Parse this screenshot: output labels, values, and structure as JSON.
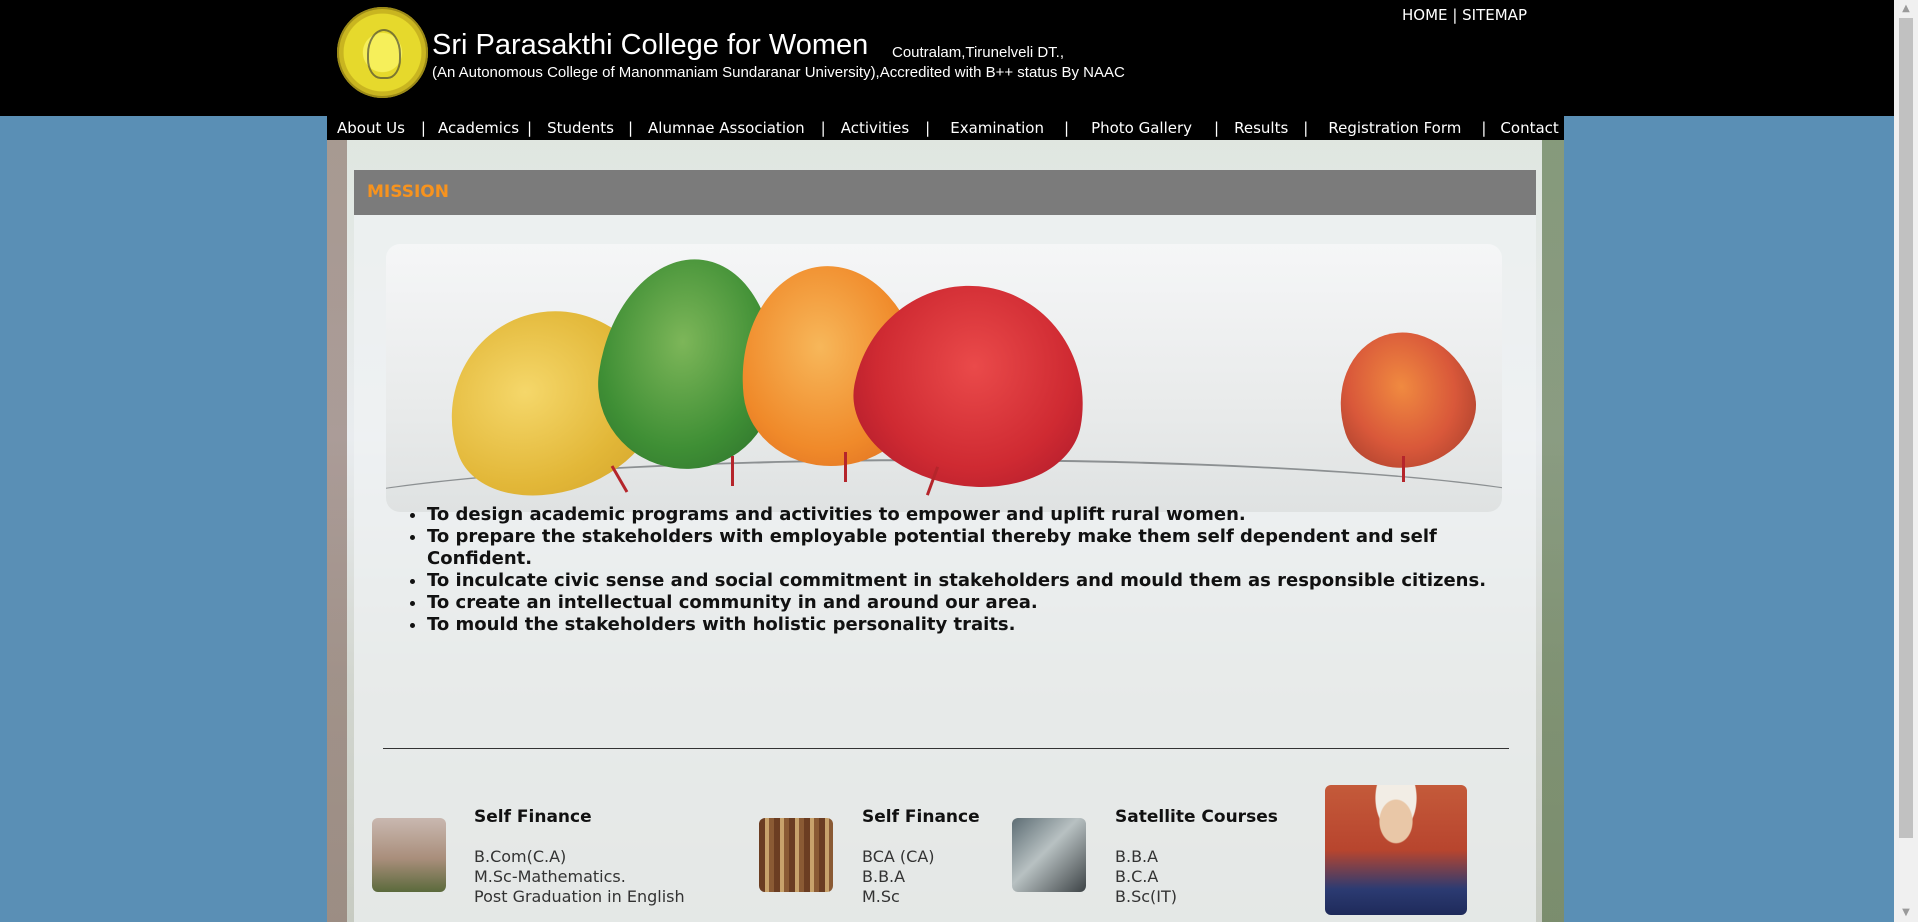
{
  "header": {
    "college_name": "Sri Parasakthi College for Women",
    "place": "Coutralam,Tirunelveli DT.,",
    "subtitle": "(An Autonomous College of Manonmaniam Sundaranar University),Accredited with B++ status By NAAC",
    "top_links": {
      "home": "HOME",
      "separator": "|",
      "sitemap": "SITEMAP"
    }
  },
  "nav": {
    "separator": "|",
    "items": [
      "About Us",
      "Academics",
      "Students",
      "Alumnae Association",
      "Activities",
      "Examination",
      "Photo Gallery",
      "Results",
      "Registration Form",
      "Contact"
    ]
  },
  "panel": {
    "title": "MISSION",
    "mission": [
      "To design academic programs and activities to empower and uplift rural women.",
      "To prepare the stakeholders with employable potential thereby make them self dependent and self Confident.",
      "To inculcate civic sense and social commitment in stakeholders and mould them as responsible citizens.",
      "To create an intellectual community in and around our area.",
      "To mould the stakeholders with holistic personality traits."
    ]
  },
  "courses": [
    {
      "title": "Self Finance",
      "lines": [
        "B.Com(C.A)",
        "M.Sc-Mathematics.",
        "Post Graduation in English"
      ]
    },
    {
      "title": "Self Finance",
      "lines": [
        "BCA (CA)",
        "B.B.A",
        "M.Sc"
      ]
    },
    {
      "title": "Satellite Courses",
      "lines": [
        "B.B.A",
        "B.C.A",
        "B.Sc(IT)"
      ]
    }
  ],
  "icons": {
    "logo": "college-emblem-icon",
    "thumb1": "building-photo-icon",
    "thumb2": "bookshelf-photo-icon",
    "thumb3": "computer-lab-photo-icon"
  },
  "colors": {
    "page_background": "#5a8fb5",
    "header_background": "#000000",
    "panel_header": "#7b7b7b",
    "panel_title": "#f7931e"
  }
}
